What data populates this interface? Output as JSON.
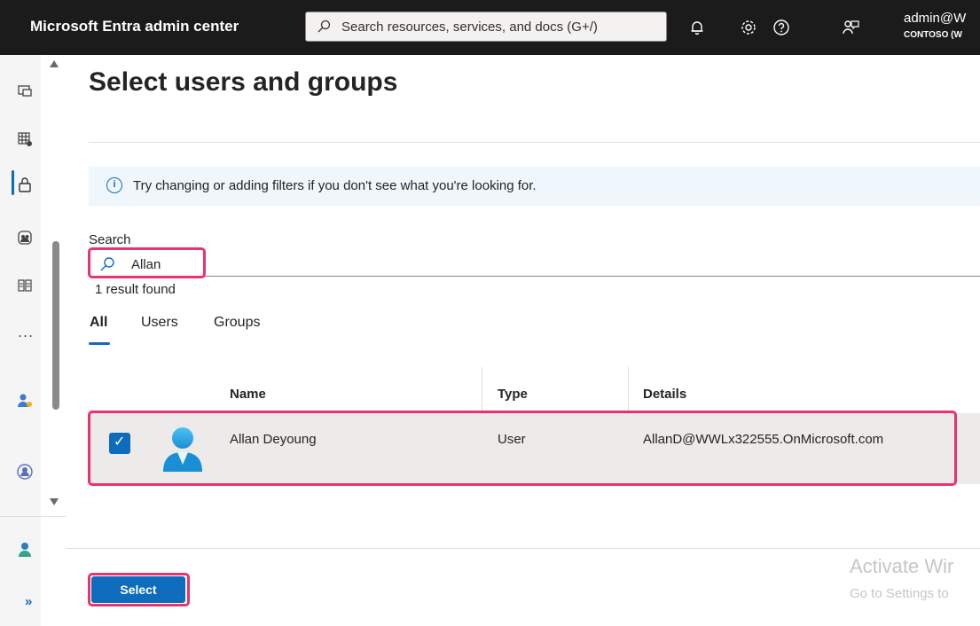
{
  "topbar": {
    "brand": "Microsoft Entra admin center",
    "search_placeholder": "Search resources, services, and docs (G+/)",
    "account_name": "admin@W",
    "account_tenant": "CONTOSO (W"
  },
  "rail": {
    "icons": [
      "dashboard-icon",
      "grid-apps-icon",
      "lock-icon",
      "identity-governance-icon",
      "app-registrations-icon",
      "more-icon",
      "user-admin-icon",
      "protection-icon",
      "account-icon",
      "expand-icon"
    ],
    "more_label": "...",
    "expand_label": "»"
  },
  "page": {
    "title": "Select users and groups",
    "info_text": "Try changing or adding filters if you don't see what you're looking for.",
    "search_label": "Search",
    "search_value": "Allan",
    "result_count": "1 result found",
    "tabs": [
      {
        "label": "All",
        "active": true
      },
      {
        "label": "Users",
        "active": false
      },
      {
        "label": "Groups",
        "active": false
      }
    ],
    "table": {
      "headers": {
        "name": "Name",
        "type": "Type",
        "details": "Details"
      },
      "rows": [
        {
          "name": "Allan Deyoung",
          "type": "User",
          "details": "AllanD@WWLx322555.OnMicrosoft.com",
          "checked": true
        }
      ]
    },
    "select_button": "Select"
  },
  "watermark": {
    "line1": "Activate Wir",
    "line2": "Go to Settings to"
  },
  "colors": {
    "accent": "#0f6cbd",
    "highlight": "#e8336b",
    "topbar_bg": "#1b1b1b"
  }
}
